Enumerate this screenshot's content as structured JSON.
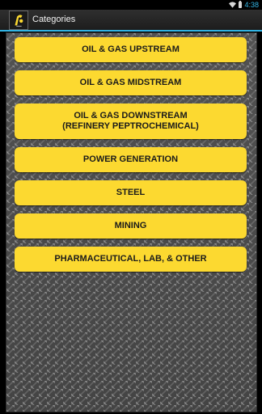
{
  "status_bar": {
    "time": "4:38",
    "wifi_icon": "wifi-icon",
    "battery_icon": "battery-icon"
  },
  "action_bar": {
    "title": "Categories",
    "app_icon": "app-logo-icon",
    "accent_color": "#33b5e5"
  },
  "categories": [
    {
      "label": "OIL & GAS UPSTREAM"
    },
    {
      "label": "OIL & GAS MIDSTREAM"
    },
    {
      "label": "OIL & GAS DOWNSTREAM",
      "label_line2": "(REFINERY PEPTROCHEMICAL)"
    },
    {
      "label": "POWER GENERATION"
    },
    {
      "label": "STEEL"
    },
    {
      "label": "MINING"
    },
    {
      "label": "PHARMACEUTICAL, LAB, & OTHER"
    }
  ],
  "button_color": "#fcd930"
}
